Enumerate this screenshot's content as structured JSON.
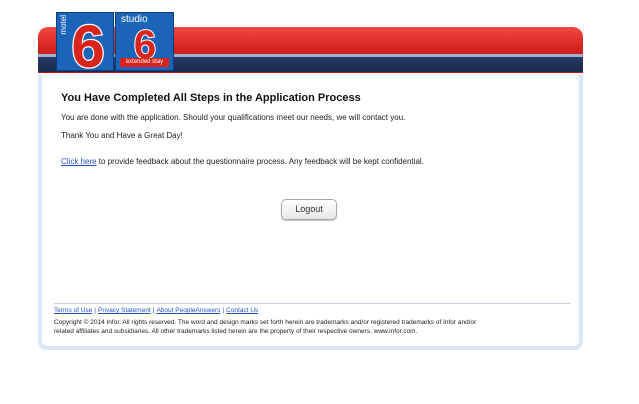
{
  "logo": {
    "motel_text": "motel",
    "studio_text": "studio",
    "six": "6",
    "extended_stay_text": "extended stay"
  },
  "content": {
    "heading": "You Have Completed All Steps in the Application Process",
    "line1": "You are done with the application.  Should your qualifications meet our needs, we will contact you.",
    "line2": "Thank You and Have a Great Day!",
    "feedback_link": "Click here",
    "feedback_rest": " to provide feedback about the questionnaire process. Any feedback will be kept confidential."
  },
  "buttons": {
    "logout": "Logout"
  },
  "footer": {
    "links": [
      "Terms of Use",
      "Privacy Statement",
      "About PeopleAnswers",
      "Contact Us"
    ],
    "separator": "|",
    "copyright_line1": "Copyright © 2014 Infor. All rights reserved. The word and design marks set forth herein are trademarks and/or registered trademarks of Infor and/or",
    "copyright_line2": "related affiliates and subsidiaries. All other trademarks listed herein are the property of their respective owners. www.infor.com."
  },
  "colors": {
    "header_red": "#d5241f",
    "header_navy": "#1a2a4f",
    "logo_blue": "#1c64b8",
    "link_blue": "#2255bb",
    "panel_border": "#dce7f4"
  }
}
